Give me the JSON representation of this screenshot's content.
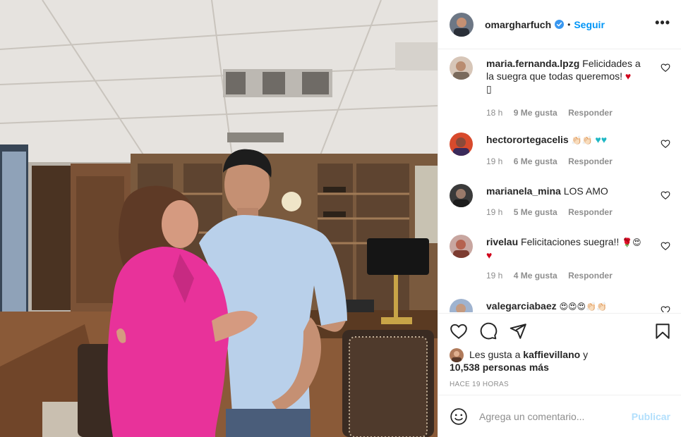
{
  "post": {
    "username": "omargharfuch",
    "verified": true,
    "separator": "•",
    "follow_label": "Seguir",
    "more_label": "•••"
  },
  "comments": [
    {
      "username": "maria.fernanda.lpzg",
      "text": "Felicidades a la suegra que todas queremos!",
      "emoji": "♥",
      "extra": "▯",
      "time": "18 h",
      "likes": "9 Me gusta",
      "reply": "Responder"
    },
    {
      "username": "hectorortegacelis",
      "text": "",
      "emoji": "👏🏻👏🏻",
      "emoji2": "♥♥",
      "time": "19 h",
      "likes": "6 Me gusta",
      "reply": "Responder"
    },
    {
      "username": "marianela_mina",
      "text": "LOS AMO",
      "time": "19 h",
      "likes": "5 Me gusta",
      "reply": "Responder"
    },
    {
      "username": "rivelau",
      "text": "Felicitaciones suegra!!",
      "emoji": "🌹😍",
      "emoji2": "♥",
      "time": "19 h",
      "likes": "4 Me gusta",
      "reply": "Responder"
    },
    {
      "username": "valegarciabaez",
      "text": "",
      "emoji": "😍😍😍👏🏻👏🏻"
    }
  ],
  "likes_summary": {
    "prefix": "Les gusta a",
    "user": "kaffievillano",
    "connector": "y",
    "others": "10,538 personas más"
  },
  "timestamp": "HACE 19 HORAS",
  "composer": {
    "placeholder": "Agrega un comentario...",
    "publish_label": "Publicar"
  },
  "colors": {
    "accent": "#0095f6",
    "publish_disabled": "#b2dffc",
    "secondary_text": "#8e8e8e",
    "divider": "#efefef",
    "jacket": "#e8329a",
    "shirt": "#b9d0ea"
  },
  "icons": [
    "verified-badge-icon",
    "more-options-icon",
    "heart-icon",
    "comment-icon",
    "share-icon",
    "bookmark-icon",
    "smile-icon"
  ]
}
